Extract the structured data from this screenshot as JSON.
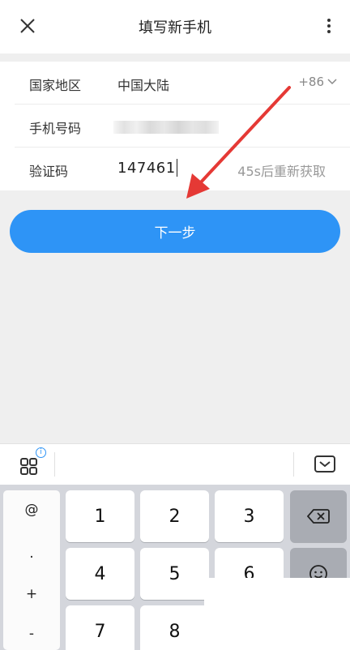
{
  "header": {
    "title": "填写新手机"
  },
  "form": {
    "region": {
      "label": "国家地区",
      "value": "中国大陆",
      "code": "+86"
    },
    "phone": {
      "label": "手机号码",
      "value": ""
    },
    "verify": {
      "label": "验证码",
      "value": "147461",
      "resend": "45s后重新获取"
    }
  },
  "next_button": {
    "label": "下一步"
  },
  "keyboard": {
    "info_badge": "i",
    "symbols": [
      "@",
      ".",
      "+",
      "-"
    ],
    "keys": [
      "1",
      "2",
      "3",
      "4",
      "5",
      "6",
      "7",
      "8"
    ]
  },
  "colors": {
    "accent": "#2e94f6",
    "arrow": "#e53935"
  }
}
